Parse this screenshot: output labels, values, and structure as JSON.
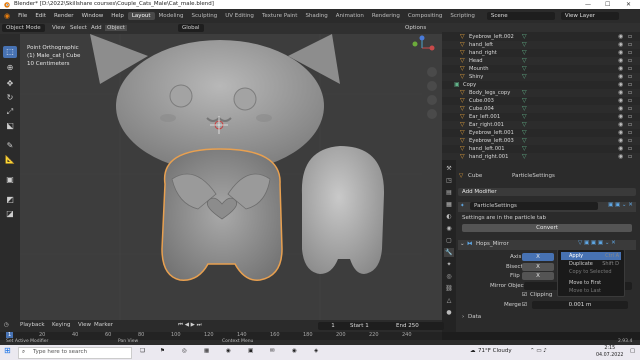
{
  "window": {
    "title": "Blender* [D:\\2022\\Skillshare courses\\Couple_Cats_Male\\Cat_male.blend]",
    "controls": [
      "—",
      "☐",
      "✕"
    ]
  },
  "menu": {
    "items": [
      "File",
      "Edit",
      "Render",
      "Window",
      "Help"
    ],
    "workspaces": [
      "Layout",
      "Modeling",
      "Sculpting",
      "UV Editing",
      "Texture Paint",
      "Shading",
      "Animation",
      "Rendering",
      "Compositing",
      "Scripting"
    ],
    "active_workspace": "Layout",
    "scene_label": "Scene",
    "view_layer_label": "View Layer"
  },
  "viewport_header": {
    "mode": "Object Mode",
    "menus": [
      "View",
      "Select",
      "Add",
      "Object"
    ],
    "transform": "Global",
    "options": "Options"
  },
  "viewport": {
    "info_line1": "Point Orthographic",
    "info_line2": "(1) Male_cat | Cube",
    "info_line3": "10 Centimeters"
  },
  "outliner": {
    "rows": [
      {
        "name": "Eyebrow_left.002",
        "indent": 2,
        "kind": "mesh"
      },
      {
        "name": "hand_left",
        "indent": 2,
        "kind": "mesh"
      },
      {
        "name": "hand_right",
        "indent": 2,
        "kind": "mesh"
      },
      {
        "name": "Head",
        "indent": 2,
        "kind": "mesh"
      },
      {
        "name": "Mounth",
        "indent": 2,
        "kind": "mesh"
      },
      {
        "name": "Shiny",
        "indent": 2,
        "kind": "mesh"
      },
      {
        "name": "Copy",
        "indent": 1,
        "kind": "collection"
      },
      {
        "name": "Body_legs_copy",
        "indent": 2,
        "kind": "mesh"
      },
      {
        "name": "Cube.003",
        "indent": 2,
        "kind": "mesh"
      },
      {
        "name": "Cube.004",
        "indent": 2,
        "kind": "mesh"
      },
      {
        "name": "Ear_left.001",
        "indent": 2,
        "kind": "mesh"
      },
      {
        "name": "Ear_right.001",
        "indent": 2,
        "kind": "mesh"
      },
      {
        "name": "Eyebrow_left.001",
        "indent": 2,
        "kind": "mesh"
      },
      {
        "name": "Eyebrow_left.003",
        "indent": 2,
        "kind": "mesh"
      },
      {
        "name": "hand_left.001",
        "indent": 2,
        "kind": "mesh"
      },
      {
        "name": "hand_right.001",
        "indent": 2,
        "kind": "mesh"
      }
    ]
  },
  "properties": {
    "object": "Cube",
    "particle_settings": "ParticleSettings",
    "add_modifier": "Add Modifier",
    "psys_name": "ParticleSettings",
    "psys_note": "Settings are in the particle tab",
    "convert_btn": "Convert",
    "mirror_name": "Hops_Mirror",
    "axis_label": "Axis",
    "bisect_label": "Bisect",
    "flip_label": "Flip",
    "x_label": "X",
    "mirror_object_label": "Mirror Object",
    "clipping_label": "Clipping",
    "merge_label": "Merge",
    "merge_value": "0.001 m",
    "data_label": "Data"
  },
  "context_menu": {
    "items": [
      {
        "label": "Apply",
        "shortcut": "Ctrl A",
        "state": "highlight"
      },
      {
        "label": "Duplicate",
        "shortcut": "Shift D",
        "state": "normal"
      },
      {
        "label": "Copy to Selected",
        "shortcut": "",
        "state": "disabled"
      },
      {
        "label": "Move to First",
        "shortcut": "",
        "state": "normal"
      },
      {
        "label": "Move to Last",
        "shortcut": "",
        "state": "disabled"
      }
    ]
  },
  "timeline": {
    "menus": [
      "Playback",
      "Keying",
      "View",
      "Marker"
    ],
    "current_frame": "1",
    "start_label": "Start",
    "start_value": "1",
    "end_label": "End",
    "end_value": "250",
    "ruler_ticks": [
      "1",
      "20",
      "40",
      "60",
      "80",
      "100",
      "120",
      "140",
      "160",
      "180",
      "200",
      "220",
      "240"
    ]
  },
  "statusbar": {
    "left": "Set Active Modifier",
    "middle1": "Pan View",
    "middle2": "Context Menu",
    "version": "2.93.4"
  },
  "taskbar": {
    "search_placeholder": "Type here to search",
    "weather": "71°F Cloudy",
    "time": "2:15",
    "date": "04.07.2022"
  },
  "colors": {
    "accent": "#4772b3",
    "selection_outline": "#e8a050",
    "collection_green": "#62b38a",
    "mesh_orange": "#e9a43c"
  }
}
